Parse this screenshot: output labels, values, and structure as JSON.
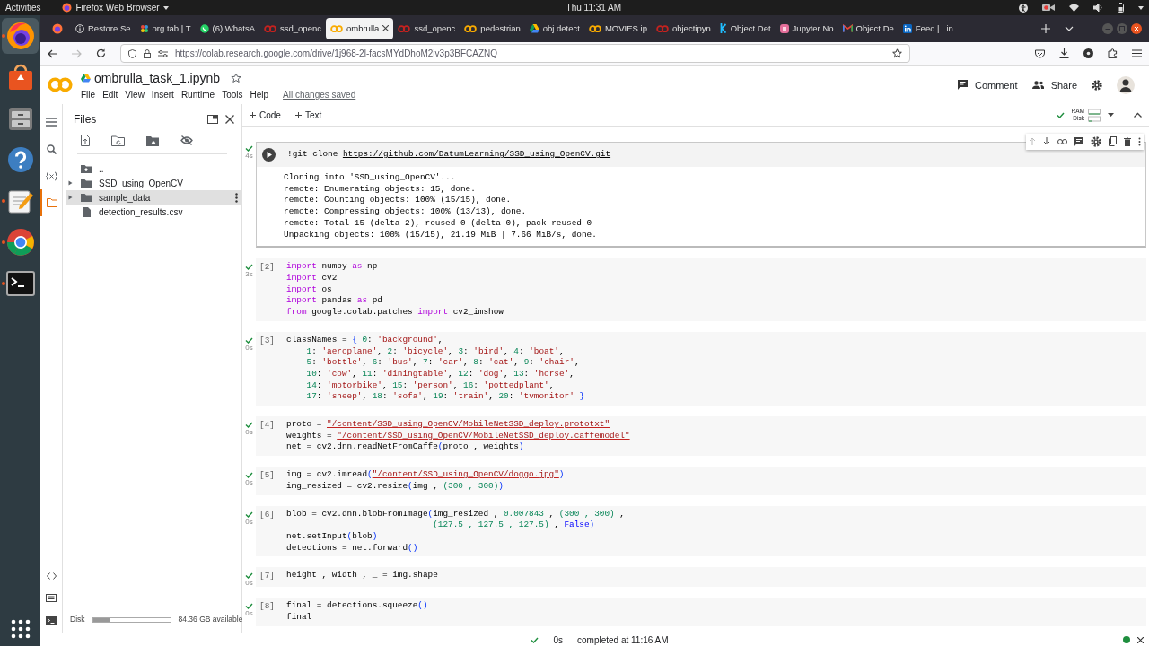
{
  "desktop": {
    "activities": "Activities",
    "app_menu": "Firefox Web Browser",
    "clock": "Thu 11:31 AM",
    "dock": [
      {
        "kind": "firefox",
        "selected": true,
        "running": true
      },
      {
        "kind": "software",
        "selected": false,
        "running": false
      },
      {
        "kind": "files",
        "selected": false,
        "running": false
      },
      {
        "kind": "help",
        "selected": false,
        "running": false
      },
      {
        "kind": "editor",
        "selected": false,
        "running": true
      },
      {
        "kind": "chrome",
        "selected": false,
        "running": true
      },
      {
        "kind": "terminal",
        "selected": false,
        "running": true
      }
    ]
  },
  "browser": {
    "tabs": [
      {
        "label": "Restore Se",
        "kind": "info",
        "selected": false
      },
      {
        "label": "org tab | T",
        "kind": "people",
        "selected": false
      },
      {
        "label": "(6) WhatsA",
        "kind": "chat",
        "selected": false
      },
      {
        "label": "ssd_openc",
        "kind": "colab",
        "color": "#c5221f",
        "selected": false
      },
      {
        "label": "ombrulla",
        "kind": "colab",
        "color": "#f9ab00",
        "selected": true
      },
      {
        "label": "ssd_openc",
        "kind": "colab",
        "color": "#c5221f",
        "selected": false
      },
      {
        "label": "pedestrian",
        "kind": "colab",
        "color": "#f9ab00",
        "selected": false
      },
      {
        "label": "obj detect",
        "kind": "drive",
        "selected": false
      },
      {
        "label": "MOVIES.ip",
        "kind": "colab",
        "color": "#f9ab00",
        "selected": false
      },
      {
        "label": "objectipyn",
        "kind": "colab",
        "color": "#c5221f",
        "selected": false
      },
      {
        "label": "Object Det",
        "kind": "kaggle",
        "selected": false
      },
      {
        "label": "Jupyter No",
        "kind": "jupyter",
        "selected": false
      },
      {
        "label": "Object De",
        "kind": "mail",
        "selected": false
      },
      {
        "label": "Feed | Lin",
        "kind": "linkedin",
        "selected": false
      }
    ],
    "url": "https://colab.research.google.com/drive/1j968-2l-facsMYdDhoM2iv3p3BFCAZNQ"
  },
  "notebook": {
    "title": "ombrulla_task_1.ipynb",
    "menu": [
      "File",
      "Edit",
      "View",
      "Insert",
      "Runtime",
      "Tools",
      "Help"
    ],
    "save_status": "All changes saved",
    "actions": [
      {
        "label": "Comment",
        "kind": "comment"
      },
      {
        "label": "Share",
        "kind": "share"
      }
    ],
    "toolbar": [
      {
        "label": "Code"
      },
      {
        "label": "Text"
      }
    ],
    "resources": {
      "ram_label": "RAM",
      "disk_label": "Disk"
    }
  },
  "rail": [
    {
      "kind": "toc",
      "selected": false
    },
    {
      "kind": "search",
      "selected": false
    },
    {
      "kind": "variables",
      "selected": false
    },
    {
      "kind": "files",
      "selected": true
    }
  ],
  "sidebar": {
    "title": "Files",
    "items": [
      {
        "label": "..",
        "kind": "parent",
        "selected": false
      },
      {
        "label": "SSD_using_OpenCV",
        "kind": "folder",
        "selected": false
      },
      {
        "label": "sample_data",
        "kind": "folder",
        "selected": true
      },
      {
        "label": "detection_results.csv",
        "kind": "file",
        "selected": false
      }
    ],
    "disk": {
      "label": "Disk",
      "level": 0.23,
      "reading": "84.36 GB available"
    }
  },
  "cells": [
    {
      "focused": true,
      "done": true,
      "time": "4s",
      "lines": [
        [
          {
            "text": "!git clone ",
            "kind": "plain"
          },
          {
            "text": "https://github.com/DatumLearning/SSD_using_OpenCV.git",
            "kind": "url"
          }
        ]
      ],
      "output": [
        "Cloning into 'SSD_using_OpenCV'...",
        "remote: Enumerating objects: 15, done.",
        "remote: Counting objects: 100% (15/15), done.",
        "remote: Compressing objects: 100% (13/13), done.",
        "remote: Total 15 (delta 2), reused 0 (delta 0), pack-reused 0",
        "Unpacking objects: 100% (15/15), 21.19 MiB | 7.66 MiB/s, done."
      ]
    },
    {
      "focused": false,
      "done": true,
      "time": "3s",
      "count": "[2]",
      "lines": [
        [
          {
            "text": "import",
            "kind": "keyword"
          },
          {
            "text": " numpy ",
            "kind": "plain"
          },
          {
            "text": "as",
            "kind": "keyword"
          },
          {
            "text": " np",
            "kind": "plain"
          }
        ],
        [
          {
            "text": "import",
            "kind": "keyword"
          },
          {
            "text": " cv2",
            "kind": "plain"
          }
        ],
        [
          {
            "text": "import",
            "kind": "keyword"
          },
          {
            "text": " os",
            "kind": "plain"
          }
        ],
        [
          {
            "text": "import",
            "kind": "keyword"
          },
          {
            "text": " pandas ",
            "kind": "plain"
          },
          {
            "text": "as",
            "kind": "keyword"
          },
          {
            "text": " pd",
            "kind": "plain"
          }
        ],
        [
          {
            "text": "from",
            "kind": "keyword"
          },
          {
            "text": " google.colab.patches ",
            "kind": "plain"
          },
          {
            "text": "import",
            "kind": "keyword"
          },
          {
            "text": " cv2_imshow",
            "kind": "plain"
          }
        ]
      ]
    },
    {
      "focused": false,
      "done": true,
      "time": "0s",
      "count": "[3]",
      "lines": [
        [
          {
            "text": "classNames = ",
            "kind": "plain"
          },
          {
            "text": "{ ",
            "kind": "bracket"
          },
          {
            "text": "0",
            "kind": "number"
          },
          {
            "text": ": ",
            "kind": "plain"
          },
          {
            "text": "'background'",
            "kind": "string"
          },
          {
            "text": ",",
            "kind": "plain"
          }
        ],
        [
          {
            "text": "    1",
            "kind": "number"
          },
          {
            "text": ": ",
            "kind": "plain"
          },
          {
            "text": "'aeroplane'",
            "kind": "string"
          },
          {
            "text": ", ",
            "kind": "plain"
          },
          {
            "text": "2",
            "kind": "number"
          },
          {
            "text": ": ",
            "kind": "plain"
          },
          {
            "text": "'bicycle'",
            "kind": "string"
          },
          {
            "text": ", ",
            "kind": "plain"
          },
          {
            "text": "3",
            "kind": "number"
          },
          {
            "text": ": ",
            "kind": "plain"
          },
          {
            "text": "'bird'",
            "kind": "string"
          },
          {
            "text": ", ",
            "kind": "plain"
          },
          {
            "text": "4",
            "kind": "number"
          },
          {
            "text": ": ",
            "kind": "plain"
          },
          {
            "text": "'boat'",
            "kind": "string"
          },
          {
            "text": ",",
            "kind": "plain"
          }
        ],
        [
          {
            "text": "    5",
            "kind": "number"
          },
          {
            "text": ": ",
            "kind": "plain"
          },
          {
            "text": "'bottle'",
            "kind": "string"
          },
          {
            "text": ", ",
            "kind": "plain"
          },
          {
            "text": "6",
            "kind": "number"
          },
          {
            "text": ": ",
            "kind": "plain"
          },
          {
            "text": "'bus'",
            "kind": "string"
          },
          {
            "text": ", ",
            "kind": "plain"
          },
          {
            "text": "7",
            "kind": "number"
          },
          {
            "text": ": ",
            "kind": "plain"
          },
          {
            "text": "'car'",
            "kind": "string"
          },
          {
            "text": ", ",
            "kind": "plain"
          },
          {
            "text": "8",
            "kind": "number"
          },
          {
            "text": ": ",
            "kind": "plain"
          },
          {
            "text": "'cat'",
            "kind": "string"
          },
          {
            "text": ", ",
            "kind": "plain"
          },
          {
            "text": "9",
            "kind": "number"
          },
          {
            "text": ": ",
            "kind": "plain"
          },
          {
            "text": "'chair'",
            "kind": "string"
          },
          {
            "text": ",",
            "kind": "plain"
          }
        ],
        [
          {
            "text": "    10",
            "kind": "number"
          },
          {
            "text": ": ",
            "kind": "plain"
          },
          {
            "text": "'cow'",
            "kind": "string"
          },
          {
            "text": ", ",
            "kind": "plain"
          },
          {
            "text": "11",
            "kind": "number"
          },
          {
            "text": ": ",
            "kind": "plain"
          },
          {
            "text": "'diningtable'",
            "kind": "string"
          },
          {
            "text": ", ",
            "kind": "plain"
          },
          {
            "text": "12",
            "kind": "number"
          },
          {
            "text": ": ",
            "kind": "plain"
          },
          {
            "text": "'dog'",
            "kind": "string"
          },
          {
            "text": ", ",
            "kind": "plain"
          },
          {
            "text": "13",
            "kind": "number"
          },
          {
            "text": ": ",
            "kind": "plain"
          },
          {
            "text": "'horse'",
            "kind": "string"
          },
          {
            "text": ",",
            "kind": "plain"
          }
        ],
        [
          {
            "text": "    14",
            "kind": "number"
          },
          {
            "text": ": ",
            "kind": "plain"
          },
          {
            "text": "'motorbike'",
            "kind": "string"
          },
          {
            "text": ", ",
            "kind": "plain"
          },
          {
            "text": "15",
            "kind": "number"
          },
          {
            "text": ": ",
            "kind": "plain"
          },
          {
            "text": "'person'",
            "kind": "string"
          },
          {
            "text": ", ",
            "kind": "plain"
          },
          {
            "text": "16",
            "kind": "number"
          },
          {
            "text": ": ",
            "kind": "plain"
          },
          {
            "text": "'pottedplant'",
            "kind": "string"
          },
          {
            "text": ",",
            "kind": "plain"
          }
        ],
        [
          {
            "text": "    17",
            "kind": "number"
          },
          {
            "text": ": ",
            "kind": "plain"
          },
          {
            "text": "'sheep'",
            "kind": "string"
          },
          {
            "text": ", ",
            "kind": "plain"
          },
          {
            "text": "18",
            "kind": "number"
          },
          {
            "text": ": ",
            "kind": "plain"
          },
          {
            "text": "'sofa'",
            "kind": "string"
          },
          {
            "text": ", ",
            "kind": "plain"
          },
          {
            "text": "19",
            "kind": "number"
          },
          {
            "text": ": ",
            "kind": "plain"
          },
          {
            "text": "'train'",
            "kind": "string"
          },
          {
            "text": ", ",
            "kind": "plain"
          },
          {
            "text": "20",
            "kind": "number"
          },
          {
            "text": ": ",
            "kind": "plain"
          },
          {
            "text": "'tvmonitor'",
            "kind": "string"
          },
          {
            "text": " }",
            "kind": "bracket"
          }
        ]
      ]
    },
    {
      "focused": false,
      "done": true,
      "time": "0s",
      "count": "[4]",
      "lines": [
        [
          {
            "text": "proto = ",
            "kind": "plain"
          },
          {
            "text": "\"/content/SSD_using_OpenCV/MobileNetSSD_deploy.prototxt\"",
            "kind": "path"
          }
        ],
        [
          {
            "text": "weights = ",
            "kind": "plain"
          },
          {
            "text": "\"/content/SSD_using_OpenCV/MobileNetSSD_deploy.caffemodel\"",
            "kind": "path"
          }
        ],
        [
          {
            "text": "net = cv2.dnn.readNetFromCaffe",
            "kind": "plain"
          },
          {
            "text": "(",
            "kind": "bracket"
          },
          {
            "text": "proto , weights",
            "kind": "plain"
          },
          {
            "text": ")",
            "kind": "bracket"
          }
        ]
      ]
    },
    {
      "focused": false,
      "done": true,
      "time": "0s",
      "count": "[5]",
      "lines": [
        [
          {
            "text": "img = cv2.imread",
            "kind": "plain"
          },
          {
            "text": "(",
            "kind": "bracket"
          },
          {
            "text": "\"/content/SSD_using_OpenCV/doggo.jpg\"",
            "kind": "path"
          },
          {
            "text": ")",
            "kind": "bracket"
          }
        ],
        [
          {
            "text": "img_resized = cv2.resize",
            "kind": "plain"
          },
          {
            "text": "(",
            "kind": "bracket"
          },
          {
            "text": "img , ",
            "kind": "plain"
          },
          {
            "text": "(300 , 300)",
            "kind": "number"
          },
          {
            "text": ")",
            "kind": "bracket"
          }
        ]
      ]
    },
    {
      "focused": false,
      "done": true,
      "time": "0s",
      "count": "[6]",
      "lines": [
        [
          {
            "text": "blob = cv2.dnn.blobFromImage",
            "kind": "plain"
          },
          {
            "text": "(",
            "kind": "bracket"
          },
          {
            "text": "img_resized , ",
            "kind": "plain"
          },
          {
            "text": "0.007843",
            "kind": "number"
          },
          {
            "text": " , ",
            "kind": "plain"
          },
          {
            "text": "(300 , 300)",
            "kind": "number"
          },
          {
            "text": " ,",
            "kind": "plain"
          }
        ],
        [
          {
            "text": "                             (127.5 , 127.5 , 127.5)",
            "kind": "number"
          },
          {
            "text": " , ",
            "kind": "plain"
          },
          {
            "text": "False",
            "kind": "constant"
          },
          {
            "text": ")",
            "kind": "bracket"
          }
        ],
        [
          {
            "text": "net.setInput",
            "kind": "plain"
          },
          {
            "text": "(",
            "kind": "bracket"
          },
          {
            "text": "blob",
            "kind": "plain"
          },
          {
            "text": ")",
            "kind": "bracket"
          }
        ],
        [
          {
            "text": "detections = net.forward",
            "kind": "plain"
          },
          {
            "text": "()",
            "kind": "bracket"
          }
        ]
      ]
    },
    {
      "focused": false,
      "done": true,
      "time": "0s",
      "count": "[7]",
      "lines": [
        [
          {
            "text": "height , width , _ = img.shape",
            "kind": "plain"
          }
        ]
      ]
    },
    {
      "focused": false,
      "done": true,
      "time": "0s",
      "count": "[8]",
      "lines": [
        [
          {
            "text": "final = detections.squeeze",
            "kind": "plain"
          },
          {
            "text": "()",
            "kind": "bracket"
          }
        ],
        [
          {
            "text": "final",
            "kind": "plain"
          }
        ]
      ]
    }
  ],
  "status_bar": {
    "time": "0s",
    "message": "completed at 11:16 AM",
    "connected": true
  }
}
